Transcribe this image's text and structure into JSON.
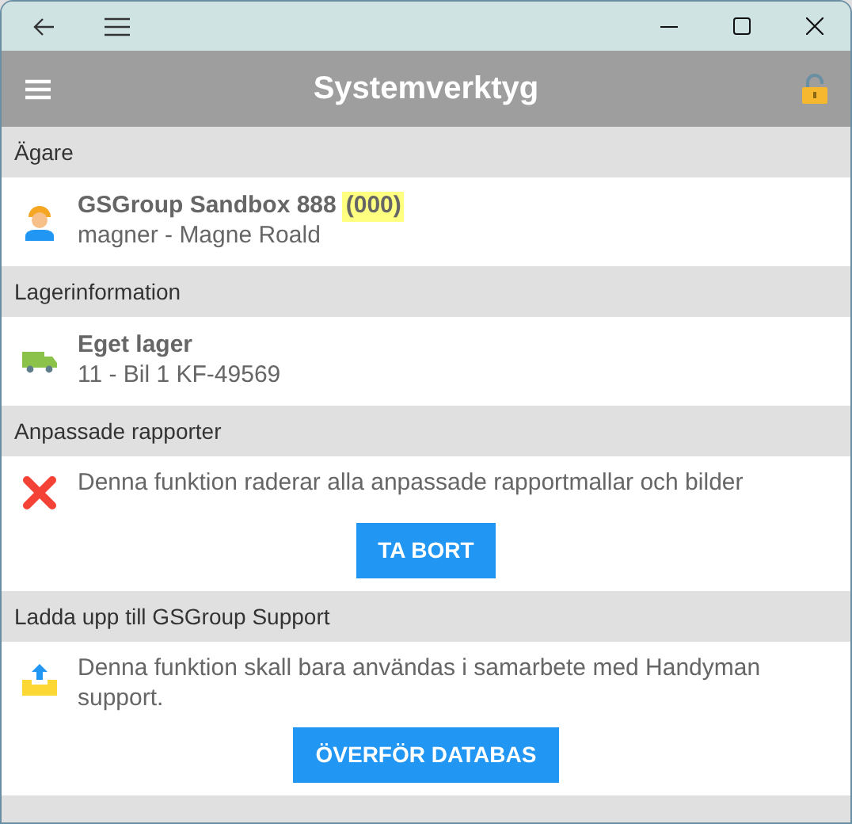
{
  "app_bar": {
    "title": "Systemverktyg",
    "locked": false
  },
  "sections": [
    {
      "header": "Ägare",
      "kind": "info",
      "title": "GSGroup Sandbox 888",
      "tag": "(000)",
      "subtitle": "magner - Magne Roald"
    },
    {
      "header": "Lagerinformation",
      "kind": "info",
      "title": "Eget lager",
      "subtitle": "11 - Bil  1  KF-49569"
    },
    {
      "header": "Anpassade rapporter",
      "kind": "action",
      "text": "Denna funktion raderar alla anpassade rapportmallar och bilder",
      "button": "TA BORT"
    },
    {
      "header": "Ladda upp till GSGroup Support",
      "kind": "action",
      "text": "Denna funktion skall bara användas i samarbete med Handyman support.",
      "button": "ÖVERFÖR DATABAS"
    }
  ]
}
